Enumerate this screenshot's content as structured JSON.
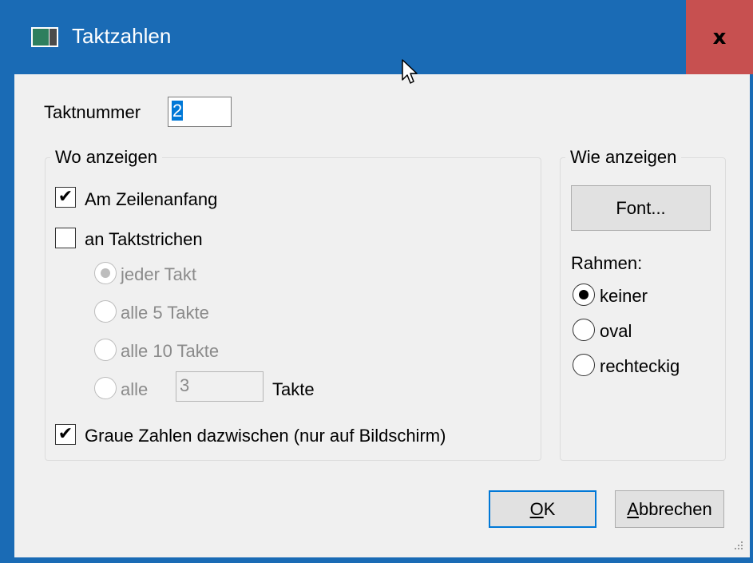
{
  "window": {
    "title": "Taktzahlen",
    "close_label": "x"
  },
  "taktnummer": {
    "label": "Taktnummer",
    "value": "2"
  },
  "wo_anzeigen": {
    "title": "Wo anzeigen",
    "am_zeilenanfang": {
      "label": "Am Zeilenanfang",
      "checked": true
    },
    "an_taktstrichen": {
      "label": "an Taktstrichen",
      "checked": false
    },
    "radios": [
      {
        "label": "jeder Takt",
        "selected": true
      },
      {
        "label": "alle 5 Takte",
        "selected": false
      },
      {
        "label": "alle 10 Takte",
        "selected": false
      },
      {
        "label": "alle",
        "selected": false
      }
    ],
    "alle_value": "3",
    "takte_suffix": "Takte",
    "graue_zahlen": {
      "label": "Graue Zahlen dazwischen (nur auf Bildschirm)",
      "checked": true
    }
  },
  "wie_anzeigen": {
    "title": "Wie anzeigen",
    "font_button": "Font...",
    "rahmen_label": "Rahmen:",
    "radios": [
      {
        "label": "keiner",
        "selected": true
      },
      {
        "label": "oval",
        "selected": false
      },
      {
        "label": "rechteckig",
        "selected": false
      }
    ]
  },
  "buttons": {
    "ok_mnemonic": "O",
    "ok_rest": "K",
    "cancel_mnemonic": "A",
    "cancel_rest": "bbrechen"
  },
  "icons": {
    "app": "taktzahlen-app-icon",
    "close": "close-icon",
    "cursor": "mouse-pointer-icon",
    "grip": "resize-grip-icon"
  },
  "colors": {
    "titlebar": "#1a6bb5",
    "close": "#c75050",
    "selection": "#0078d7",
    "disabled_text": "#8a8a8a"
  }
}
